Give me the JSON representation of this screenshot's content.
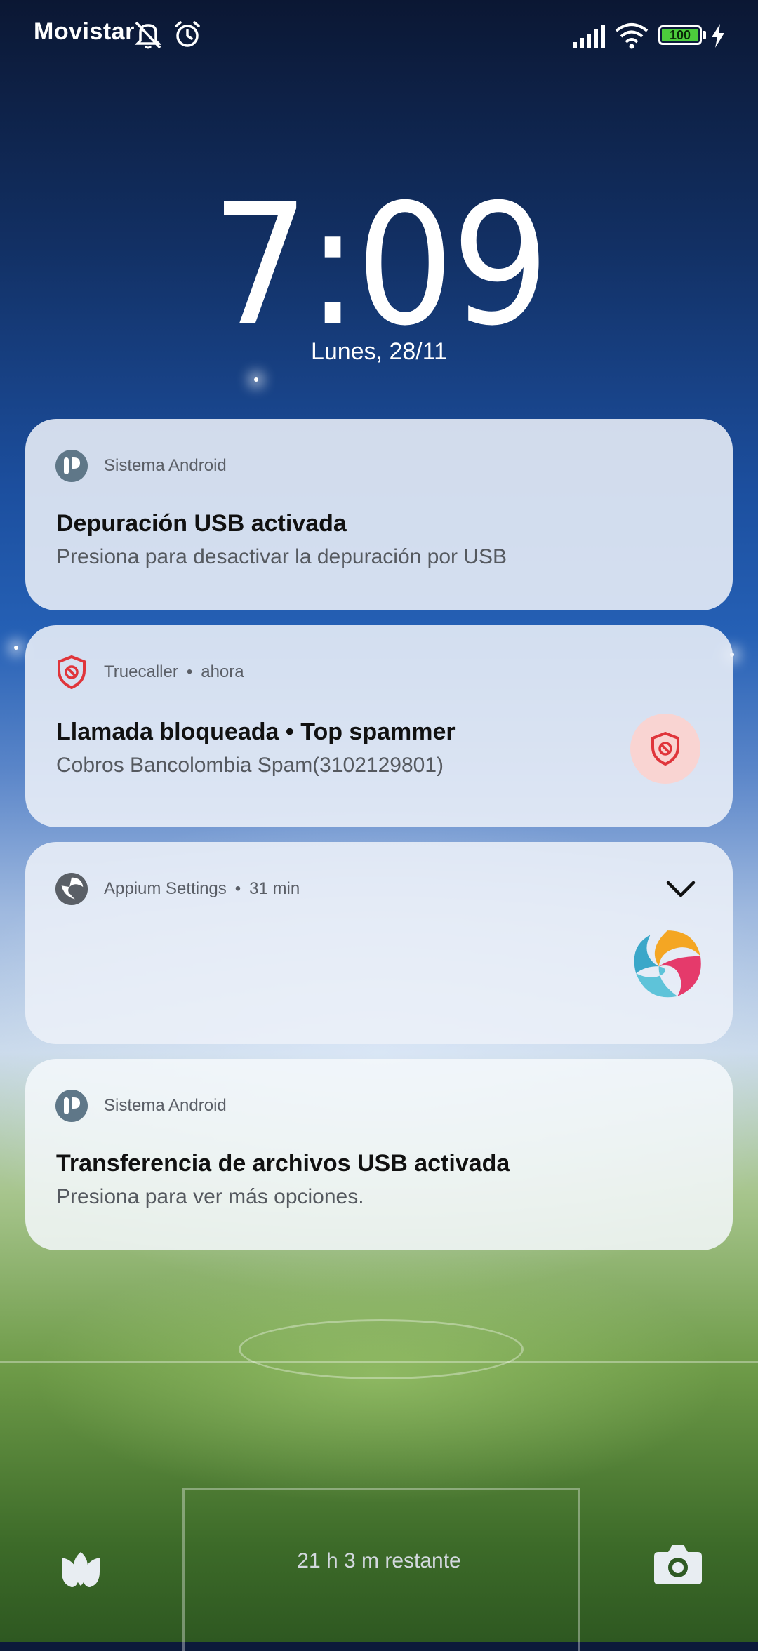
{
  "status_bar": {
    "carrier": "Movistar",
    "battery_level": "100",
    "icons": [
      "mute-icon",
      "alarm-icon",
      "signal-icon",
      "wifi-icon",
      "battery-icon",
      "charging-icon"
    ]
  },
  "lock_screen": {
    "time": "7:09",
    "date": "Lunes, 28/11"
  },
  "notifications": [
    {
      "app": "Sistema Android",
      "time": "",
      "title": "Depuración USB activada",
      "body": "Presiona para desactivar la depuración por USB",
      "icon": "android-system-icon"
    },
    {
      "app": "Truecaller",
      "time": "ahora",
      "title": "Llamada bloqueada • Top spammer",
      "body": "Cobros Bancolombia Spam(3102129801)",
      "icon": "truecaller-shield-icon",
      "accent": "#e0353b"
    },
    {
      "app": "Appium Settings",
      "time": "31 min",
      "title": "",
      "body": "",
      "icon": "appium-icon"
    },
    {
      "app": "Sistema Android",
      "time": "",
      "title": "Transferencia de archivos USB activada",
      "body": "Presiona para ver más opciones.",
      "icon": "android-system-icon"
    }
  ],
  "bottom": {
    "remaining": "21 h 3 m restante",
    "left_shortcut_icon": "lotus-icon",
    "right_shortcut_icon": "camera-icon"
  },
  "colors": {
    "card_background": "#ecf0f8",
    "battery_fill": "#4ccd3c",
    "truecaller_red": "#e0353b"
  }
}
